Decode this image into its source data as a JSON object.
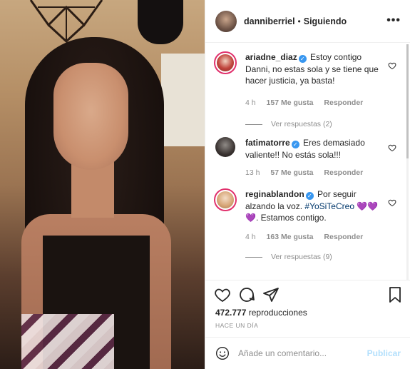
{
  "post": {
    "username": "danniberriel",
    "separator": "•",
    "follow_status": "Siguiendo",
    "more_icon": "more-options-icon",
    "more_label": "•••"
  },
  "comments": [
    {
      "username": "ariadne_diaz",
      "text": "Estoy contigo Danni, no estas sola y se tiene que hacer justicia, ya basta!",
      "time": "4 h",
      "likes": "157 Me gusta",
      "reply": "Responder",
      "view_replies": "Ver respuestas (2)"
    },
    {
      "username": "fatimatorre",
      "text": "Eres demasiado valiente!! No estás sola!!!",
      "time": "13 h",
      "likes": "57 Me gusta",
      "reply": "Responder"
    },
    {
      "username": "reginablandon",
      "text_before": "Por seguir alzando la voz. ",
      "hashtag": "#YoSiTeCreo",
      "hearts_inline": " 💜💜",
      "hearts_next": "💜",
      "text_after": ". Estamos contigo.",
      "time": "4 h",
      "likes": "163 Me gusta",
      "reply": "Responder",
      "view_replies": "Ver respuestas (9)"
    }
  ],
  "actions": {
    "views_count": "472.777",
    "views_label": "reproducciones",
    "time_ago": "HACE UN DÍA"
  },
  "add_comment": {
    "placeholder": "Añade un comentario...",
    "publish_label": "Publicar"
  },
  "colors": {
    "verified": "#3897f0",
    "hashtag": "#00376b",
    "publish_disabled": "#b2dffc",
    "meta": "#8e8e8e"
  }
}
